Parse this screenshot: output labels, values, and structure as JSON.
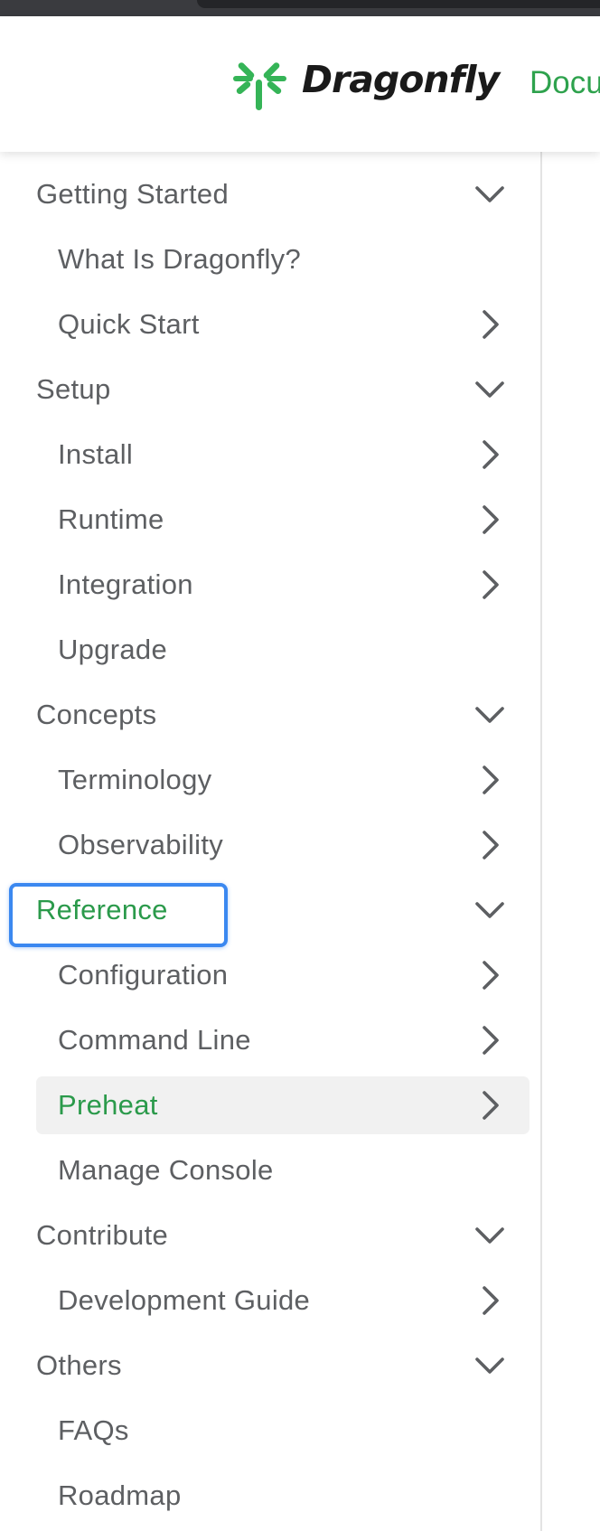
{
  "header": {
    "logo_text": "Dragonfly",
    "nav_link": "Docu",
    "brand_color": "#2ea24d"
  },
  "sidebar": {
    "items": [
      {
        "label": "Getting Started",
        "level": "section",
        "chevron": "down"
      },
      {
        "label": "What Is Dragonfly?",
        "level": "child",
        "chevron": "none"
      },
      {
        "label": "Quick Start",
        "level": "child",
        "chevron": "right"
      },
      {
        "label": "Setup",
        "level": "section",
        "chevron": "down"
      },
      {
        "label": "Install",
        "level": "child",
        "chevron": "right"
      },
      {
        "label": "Runtime",
        "level": "child",
        "chevron": "right"
      },
      {
        "label": "Integration",
        "level": "child",
        "chevron": "right"
      },
      {
        "label": "Upgrade",
        "level": "child",
        "chevron": "none"
      },
      {
        "label": "Concepts",
        "level": "section",
        "chevron": "down"
      },
      {
        "label": "Terminology",
        "level": "child",
        "chevron": "right"
      },
      {
        "label": "Observability",
        "level": "child",
        "chevron": "right"
      },
      {
        "label": "Reference",
        "level": "section",
        "chevron": "down",
        "active": true,
        "focused": true
      },
      {
        "label": "Configuration",
        "level": "child",
        "chevron": "right"
      },
      {
        "label": "Command Line",
        "level": "child",
        "chevron": "right"
      },
      {
        "label": "Preheat",
        "level": "child",
        "chevron": "right",
        "active": true,
        "selected": true
      },
      {
        "label": "Manage Console",
        "level": "child",
        "chevron": "none"
      },
      {
        "label": "Contribute",
        "level": "section",
        "chevron": "down"
      },
      {
        "label": "Development Guide",
        "level": "child",
        "chevron": "right"
      },
      {
        "label": "Others",
        "level": "section",
        "chevron": "down"
      },
      {
        "label": "FAQs",
        "level": "child",
        "chevron": "none"
      },
      {
        "label": "Roadmap",
        "level": "child",
        "chevron": "none"
      }
    ]
  },
  "colors": {
    "active_text": "#2b9a4b",
    "text": "#5d5f62",
    "selected_bg": "#f1f1f1",
    "focus_outline": "#3b88f0"
  }
}
